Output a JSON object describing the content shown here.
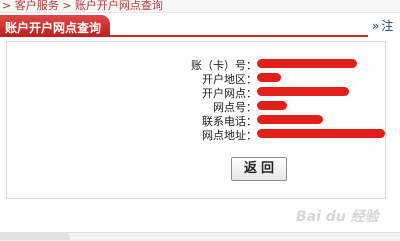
{
  "breadcrumb": "> 客户服务 > 账户开户网点查询",
  "title": "账户开户网点查询",
  "note_link": "注",
  "fields": [
    {
      "label": "账（卡）号："
    },
    {
      "label": "开户地区："
    },
    {
      "label": "开户网点："
    },
    {
      "label": "网点号："
    },
    {
      "label": "联系电话："
    },
    {
      "label": "网点地址："
    }
  ],
  "back_button": "返回",
  "watermark": "Bai du 经验",
  "colors": {
    "accent": "#c32a2a",
    "redaction": "#e2201a"
  }
}
